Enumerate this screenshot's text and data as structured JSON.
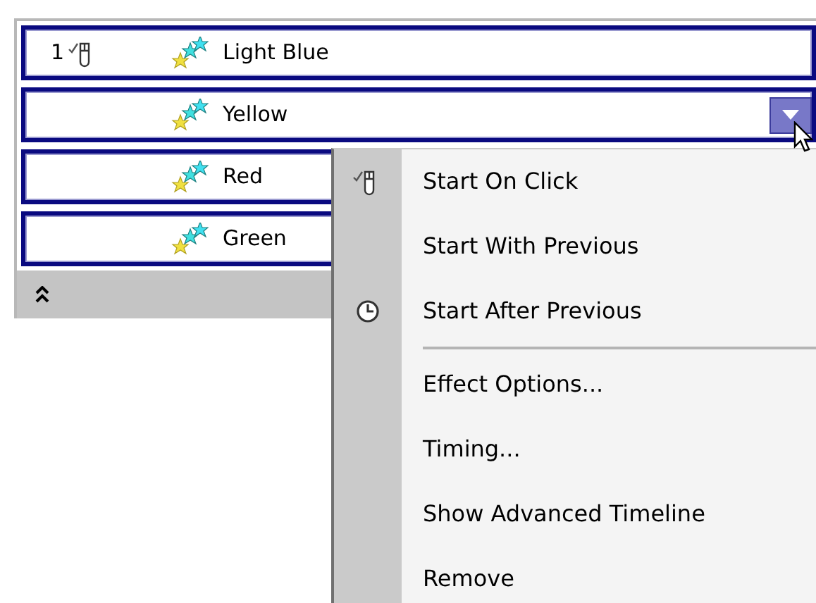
{
  "effects": [
    {
      "order": "1",
      "kind": "on_click",
      "name": "Light Blue",
      "hovered": false
    },
    {
      "kind": "with_previous",
      "name": "Yellow",
      "hovered": true
    },
    {
      "kind": "with_previous",
      "name": "Red"
    },
    {
      "kind": "with_previous",
      "name": "Green"
    }
  ],
  "menu": [
    {
      "kind": "click",
      "label": "Start On Click"
    },
    {
      "kind": "item",
      "label": "Start With Previous"
    },
    {
      "kind": "after",
      "label": "Start After Previous"
    },
    {
      "kind": "separator"
    },
    {
      "kind": "item",
      "label": "Effect Options..."
    },
    {
      "kind": "item",
      "label": "Timing..."
    },
    {
      "kind": "item",
      "label": "Show Advanced Timeline"
    },
    {
      "kind": "item",
      "label": "Remove"
    }
  ]
}
